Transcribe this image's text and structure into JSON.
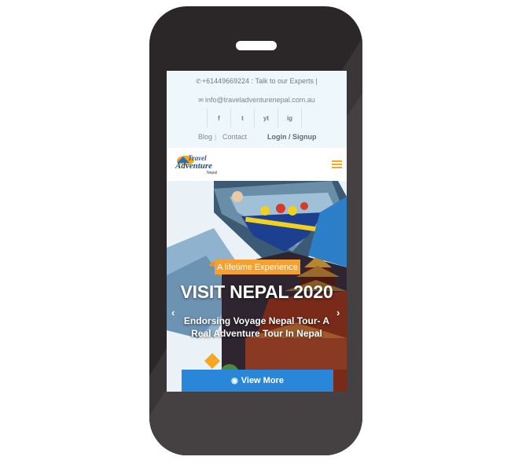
{
  "topbar": {
    "phone_text": "+61449669224 : Talk to our Experts  |",
    "email_text": "info@traveladventurenepal.com.au",
    "social": [
      "f",
      "t",
      "yt",
      "ig"
    ],
    "links": {
      "blog": "Blog",
      "contact": "Contact",
      "login_signup": "Login / Signup"
    }
  },
  "logo": {
    "line1": "Travel",
    "line2": "Adventure",
    "line3": "Nepal"
  },
  "hero": {
    "badge": "A lifetime Experience",
    "title": "VISIT NEPAL 2020",
    "subtitle": "Endorsing Voyage Nepal Tour- A Real Adventure Tour In Nepal",
    "prev_icon": "chevron-left-icon",
    "next_icon": "chevron-right-icon",
    "cta_label": "View More"
  },
  "colors": {
    "phone": "#2b2728",
    "topbar_bg": "#eef8fc",
    "accent": "#f5a033",
    "cta": "#2a86d8"
  }
}
